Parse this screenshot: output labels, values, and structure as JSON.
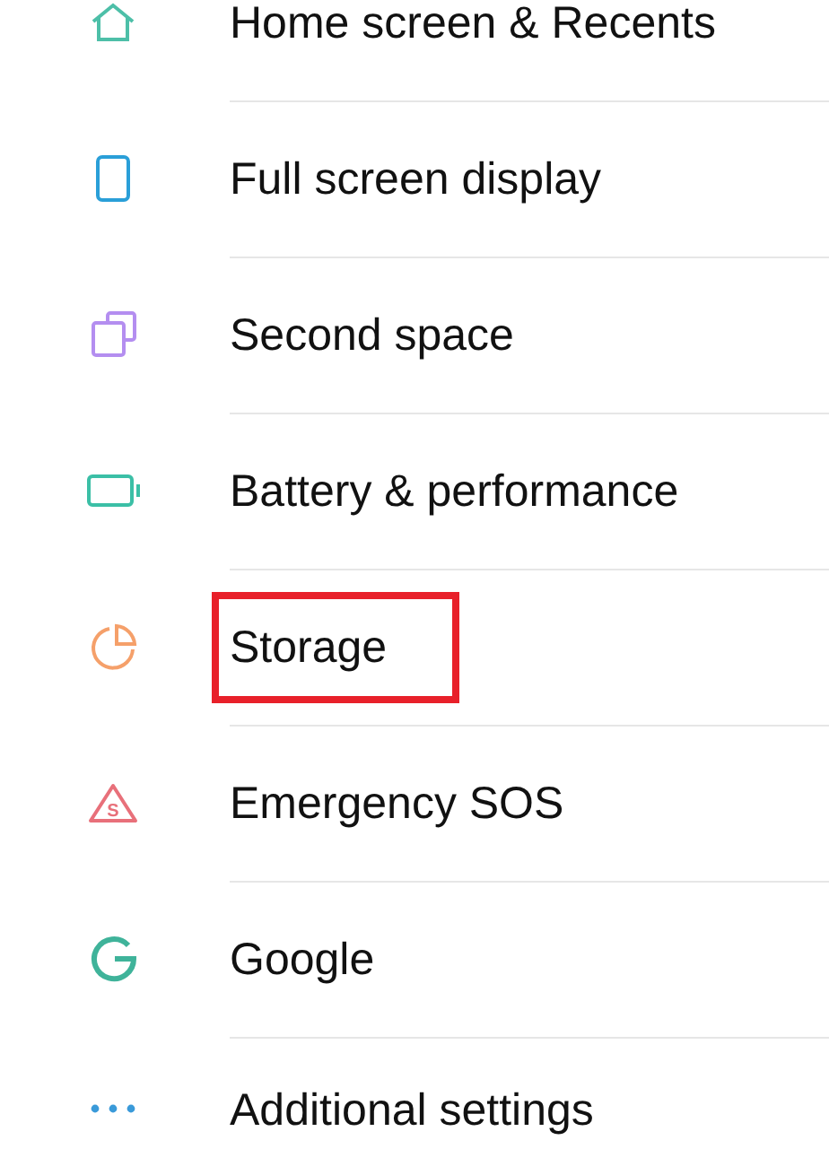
{
  "settings_items": [
    {
      "kind": "home",
      "label": "Home screen & Recents",
      "highlighted": false
    },
    {
      "kind": "phone",
      "label": "Full screen display",
      "highlighted": false
    },
    {
      "kind": "copy",
      "label": "Second space",
      "highlighted": false
    },
    {
      "kind": "battery",
      "label": "Battery & performance",
      "highlighted": false
    },
    {
      "kind": "pie",
      "label": "Storage",
      "highlighted": true
    },
    {
      "kind": "sos",
      "label": "Emergency SOS",
      "badge": "S",
      "highlighted": false
    },
    {
      "kind": "google",
      "label": "Google",
      "highlighted": false
    },
    {
      "kind": "dots",
      "label": "Additional settings",
      "highlighted": false
    }
  ]
}
